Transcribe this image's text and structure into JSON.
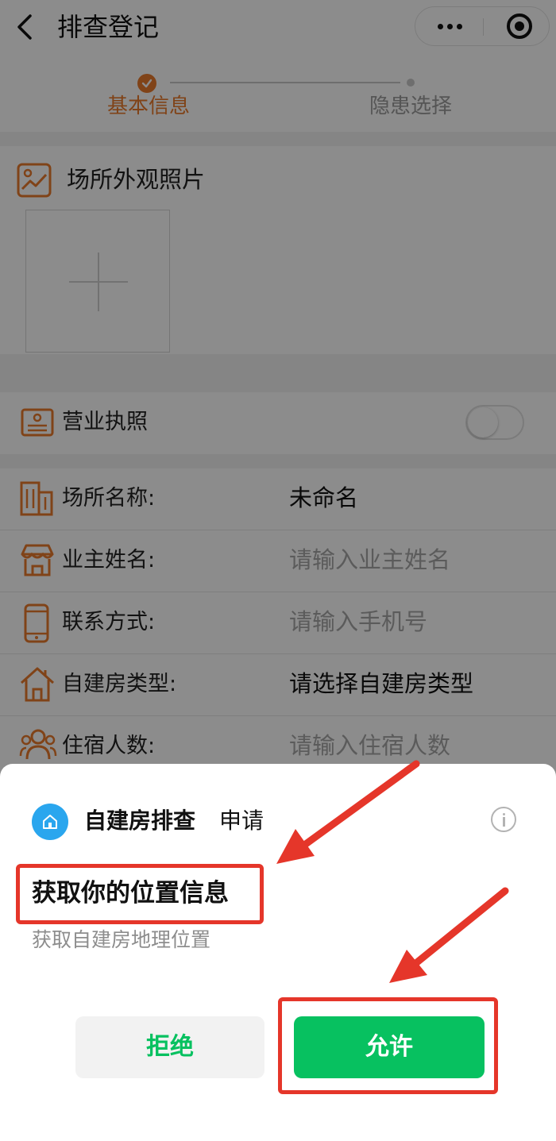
{
  "nav": {
    "title": "排查登记",
    "back_icon": "chevron-left-icon",
    "more_icon": "more-dots-icon",
    "close_icon": "target-close-icon"
  },
  "steps": [
    {
      "label": "基本信息",
      "state": "done"
    },
    {
      "label": "隐患选择",
      "state": "pending"
    }
  ],
  "photo_section": {
    "title": "场所外观照片",
    "icon": "image-icon",
    "add_icon": "plus-icon"
  },
  "license": {
    "label": "营业执照",
    "icon": "id-card-icon",
    "enabled": false
  },
  "form": {
    "rows": [
      {
        "label": "场所名称:",
        "value": "未命名",
        "placeholder": "",
        "icon": "building-icon"
      },
      {
        "label": "业主姓名:",
        "value": "",
        "placeholder": "请输入业主姓名",
        "icon": "shop-icon"
      },
      {
        "label": "联系方式:",
        "value": "",
        "placeholder": "请输入手机号",
        "icon": "phone-icon"
      },
      {
        "label": "自建房类型:",
        "value": "请选择自建房类型",
        "placeholder": "",
        "icon": "house-icon"
      },
      {
        "label": "住宿人数:",
        "value": "",
        "placeholder": "请输入住宿人数",
        "icon": "people-icon"
      }
    ]
  },
  "permission_sheet": {
    "app_name": "自建房排查",
    "apply_text": "申请",
    "title": "获取你的位置信息",
    "description": "获取自建房地理位置",
    "deny_label": "拒绝",
    "allow_label": "允许",
    "info_icon": "info-icon"
  },
  "colors": {
    "accent": "#ea7a2c",
    "wechat_green": "#07c160",
    "annotation_red": "#e5362a"
  }
}
